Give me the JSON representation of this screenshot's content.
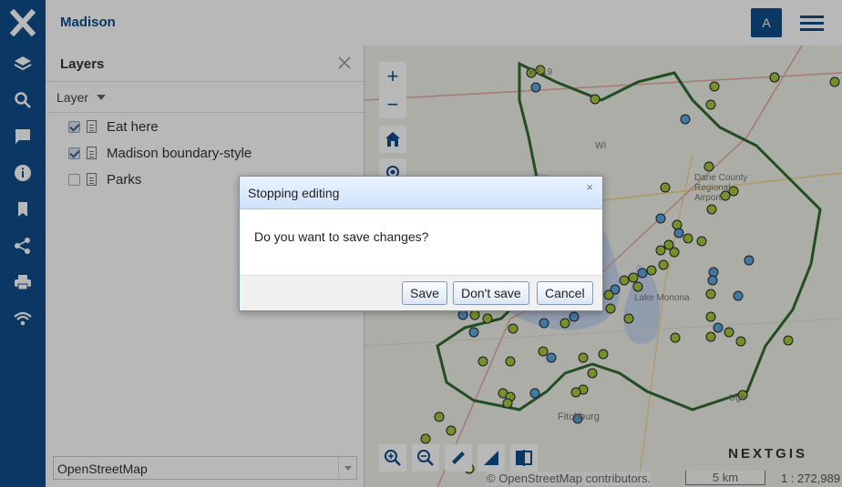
{
  "header": {
    "app_title": "Madison",
    "avatar_letter": "A"
  },
  "panel": {
    "title": "Layers",
    "column_label": "Layer",
    "layers": [
      {
        "name": "Eat here",
        "checked": true
      },
      {
        "name": "Madison boundary-style",
        "checked": true
      },
      {
        "name": "Parks",
        "checked": false
      }
    ],
    "basemap": "OpenStreetMap"
  },
  "map": {
    "zoom_in": "+",
    "zoom_out": "−",
    "brand": "NEXTGIS",
    "attribution": "© OpenStreetMap contributors.",
    "scale_label": "5 km",
    "scale_ratio": "1 : 272,989",
    "labels": [
      "WI 19",
      "WI",
      "Dane County Regional Airport",
      "Fitchburg",
      "Lake Monona",
      "Ugh"
    ],
    "colors": {
      "boundary": "#2f6b2f",
      "point_green": "#a6c93a",
      "point_blue": "#5fa8dc"
    }
  },
  "dialog": {
    "title": "Stopping editing",
    "close": "×",
    "message": "Do you want to save changes?",
    "buttons": {
      "save": "Save",
      "dont_save": "Don't save",
      "cancel": "Cancel"
    }
  }
}
